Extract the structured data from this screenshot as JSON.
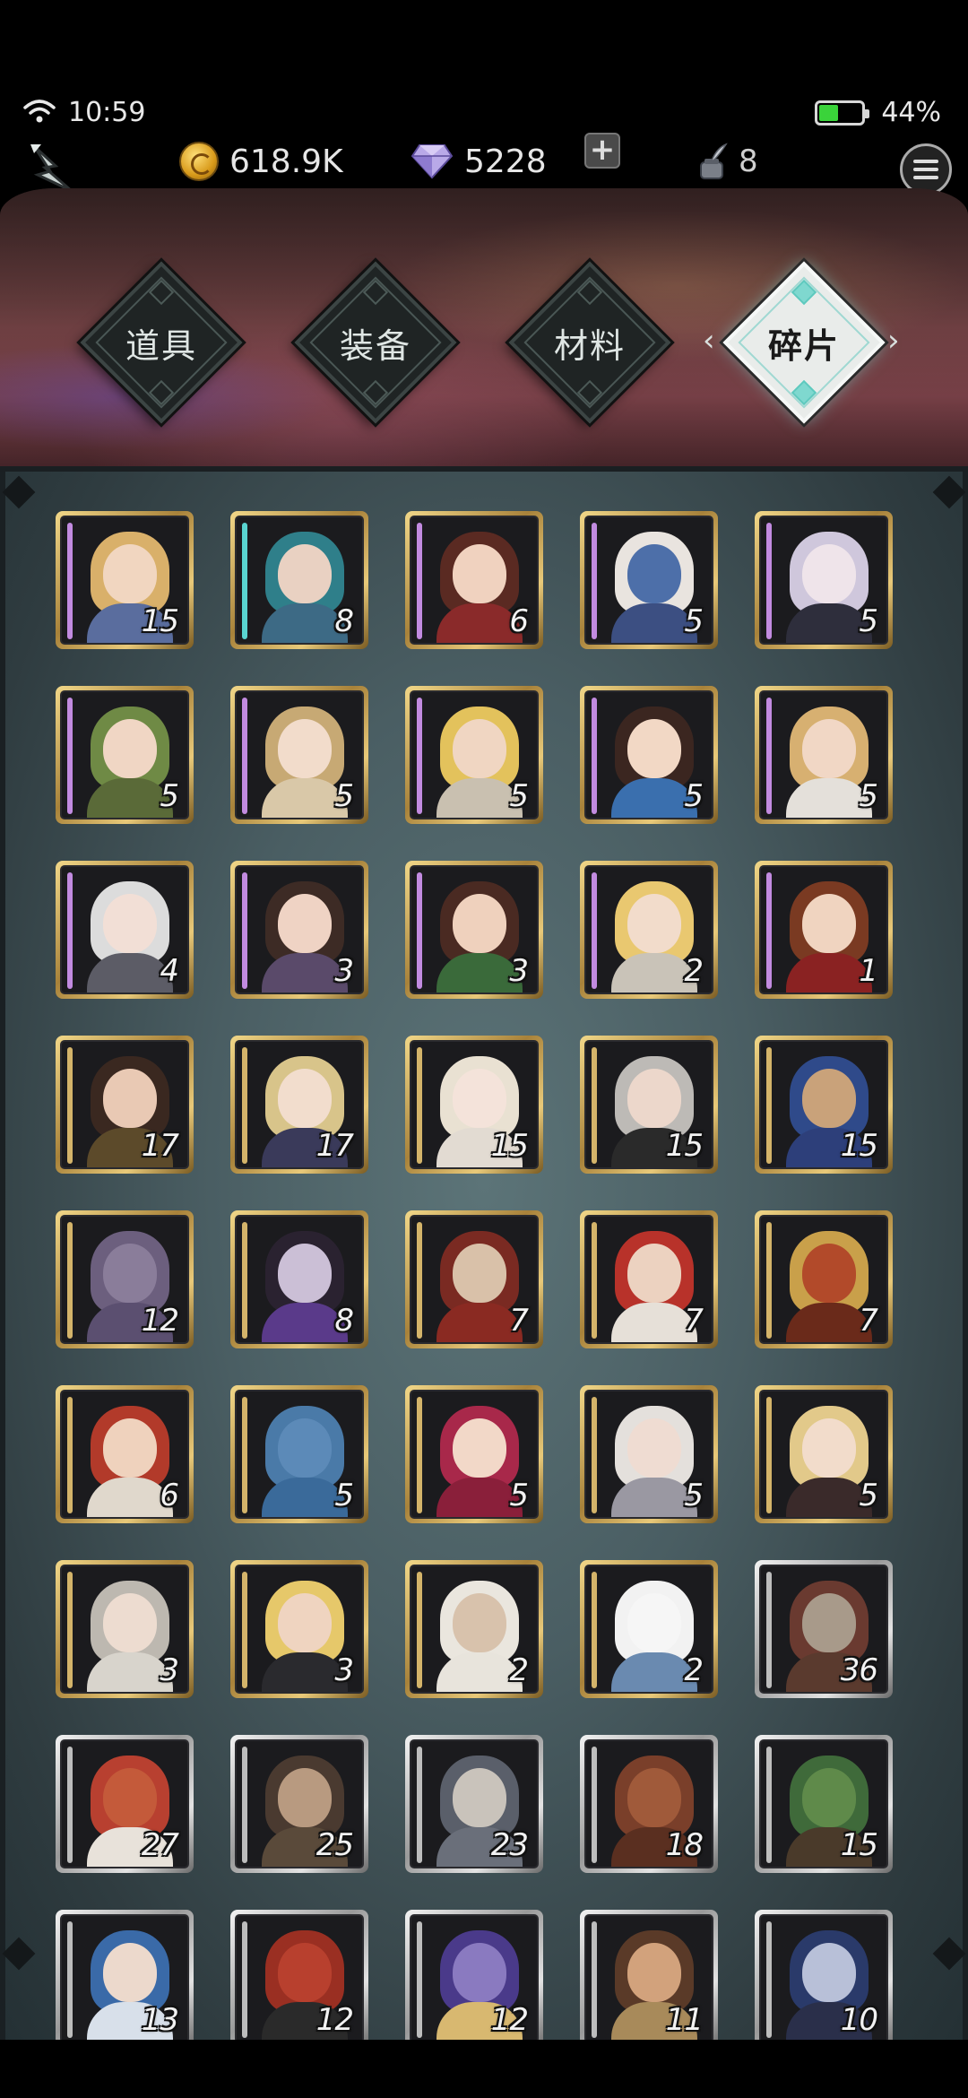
{
  "status_bar": {
    "time": "10:59",
    "battery_percent": "44%",
    "battery_level": 0.44
  },
  "resources": {
    "gold": "618.9K",
    "gems": "5228",
    "ink": "8"
  },
  "tabs": [
    {
      "label": "道具",
      "active": false
    },
    {
      "label": "装备",
      "active": false
    },
    {
      "label": "材料",
      "active": false
    },
    {
      "label": "碎片",
      "active": true
    }
  ],
  "icons": {
    "back": "back-arrow-icon",
    "gold": "gold-coin-icon",
    "gem": "diamond-gem-icon",
    "add": "plus-icon",
    "ink": "ink-quill-icon",
    "menu": "hamburger-menu-icon",
    "wifi": "wifi-icon",
    "battery": "battery-icon"
  },
  "colors": {
    "frame_gold": "#d4b46a",
    "frame_silver": "#d0d0d0",
    "active_tab": "#e9ecea",
    "accent_teal": "#5ec9be"
  },
  "fragments": [
    {
      "count": "15",
      "frame": "gold",
      "hair": "#d9b06a",
      "skin": "#f1d6c0",
      "outfit": "#5a6d9e",
      "edge": "#c28be0"
    },
    {
      "count": "8",
      "frame": "gold",
      "hair": "#2f7f8a",
      "skin": "#e9d1c2",
      "outfit": "#3d6a85",
      "edge": "#59d4d0"
    },
    {
      "count": "6",
      "frame": "gold",
      "hair": "#5a2a22",
      "skin": "#f0d2bf",
      "outfit": "#8a2a2a",
      "edge": "#c28be0"
    },
    {
      "count": "5",
      "frame": "gold",
      "hair": "#e9e4df",
      "skin": "#4d6fa9",
      "outfit": "#3c4f82",
      "edge": "#c28be0"
    },
    {
      "count": "5",
      "frame": "gold",
      "hair": "#cfc7dc",
      "skin": "#efe4ea",
      "outfit": "#2e2e3c",
      "edge": "#c28be0"
    },
    {
      "count": "5",
      "frame": "gold",
      "hair": "#6f8a45",
      "skin": "#f0d6c4",
      "outfit": "#5a6a38",
      "edge": "#c28be0"
    },
    {
      "count": "5",
      "frame": "gold",
      "hair": "#c7a974",
      "skin": "#f2dccb",
      "outfit": "#d9c8a8",
      "edge": "#c28be0"
    },
    {
      "count": "5",
      "frame": "gold",
      "hair": "#e3c25c",
      "skin": "#f0d6c2",
      "outfit": "#c9c0b0",
      "edge": "#c28be0"
    },
    {
      "count": "5",
      "frame": "gold",
      "hair": "#3b2620",
      "skin": "#f2d8c5",
      "outfit": "#3a6fae",
      "edge": "#c28be0"
    },
    {
      "count": "5",
      "frame": "gold",
      "hair": "#d7b071",
      "skin": "#f1d7c5",
      "outfit": "#e4e0da",
      "edge": "#c28be0"
    },
    {
      "count": "4",
      "frame": "gold",
      "hair": "#dcdcdc",
      "skin": "#f2dfd6",
      "outfit": "#5c5c66",
      "edge": "#c28be0"
    },
    {
      "count": "3",
      "frame": "gold",
      "hair": "#3d2b25",
      "skin": "#efd3c4",
      "outfit": "#5a4a6a",
      "edge": "#c28be0"
    },
    {
      "count": "3",
      "frame": "gold",
      "hair": "#4a2a22",
      "skin": "#efd1bd",
      "outfit": "#3a6a3a",
      "edge": "#c28be0"
    },
    {
      "count": "2",
      "frame": "gold",
      "hair": "#e9c870",
      "skin": "#f2dccb",
      "outfit": "#c9c3b8",
      "edge": "#c28be0"
    },
    {
      "count": "1",
      "frame": "gold",
      "hair": "#7a3a22",
      "skin": "#f0d4c0",
      "outfit": "#8a2222",
      "edge": "#c28be0"
    },
    {
      "count": "17",
      "frame": "gold",
      "hair": "#3a2820",
      "skin": "#e9c9b4",
      "outfit": "#5c4a2a",
      "edge": "#d4b46a"
    },
    {
      "count": "17",
      "frame": "gold",
      "hair": "#d8c48a",
      "skin": "#f2ddcd",
      "outfit": "#3a3a5a",
      "edge": "#d4b46a"
    },
    {
      "count": "15",
      "frame": "gold",
      "hair": "#e9e1d2",
      "skin": "#f4e3da",
      "outfit": "#e2dbd2",
      "edge": "#d4b46a"
    },
    {
      "count": "15",
      "frame": "gold",
      "hair": "#bdbab6",
      "skin": "#ecd7cb",
      "outfit": "#2a2a2a",
      "edge": "#d4b46a"
    },
    {
      "count": "15",
      "frame": "gold",
      "hair": "#2f4a8a",
      "skin": "#c9a27a",
      "outfit": "#2d3f7a",
      "edge": "#d4b46a"
    },
    {
      "count": "12",
      "frame": "gold",
      "hair": "#6c5f7e",
      "skin": "#8a7d9a",
      "outfit": "#5b4f70",
      "edge": "#d4b46a"
    },
    {
      "count": "8",
      "frame": "gold",
      "hair": "#2a2230",
      "skin": "#cbbfd6",
      "outfit": "#5a3a8a",
      "edge": "#d4b46a"
    },
    {
      "count": "7",
      "frame": "gold",
      "hair": "#7a2a22",
      "skin": "#d9c1a9",
      "outfit": "#8a2a22",
      "edge": "#d4b46a"
    },
    {
      "count": "7",
      "frame": "gold",
      "hair": "#b8322a",
      "skin": "#ecd2c0",
      "outfit": "#e6e0d8",
      "edge": "#d4b46a"
    },
    {
      "count": "7",
      "frame": "gold",
      "hair": "#c9a04a",
      "skin": "#b24a2a",
      "outfit": "#6a2a1a",
      "edge": "#d4b46a"
    },
    {
      "count": "6",
      "frame": "gold",
      "hair": "#b23a2a",
      "skin": "#efd2bd",
      "outfit": "#e0d8cc",
      "edge": "#d4b46a"
    },
    {
      "count": "5",
      "frame": "gold",
      "hair": "#4a7aa8",
      "skin": "#5c8ab8",
      "outfit": "#3a6a9a",
      "edge": "#d4b46a"
    },
    {
      "count": "5",
      "frame": "gold",
      "hair": "#a8284a",
      "skin": "#f2d8c8",
      "outfit": "#8a1f3a",
      "edge": "#d4b46a"
    },
    {
      "count": "5",
      "frame": "gold",
      "hair": "#e4e0dc",
      "skin": "#efdcd2",
      "outfit": "#9a98a2",
      "edge": "#d4b46a"
    },
    {
      "count": "5",
      "frame": "gold",
      "hair": "#e2c98a",
      "skin": "#f2dccb",
      "outfit": "#3a2a2a",
      "edge": "#d4b46a"
    },
    {
      "count": "3",
      "frame": "gold",
      "hair": "#bdb8b0",
      "skin": "#eddcd0",
      "outfit": "#d8d4cc",
      "edge": "#d4b46a"
    },
    {
      "count": "3",
      "frame": "gold",
      "hair": "#e6c86a",
      "skin": "#efd4c0",
      "outfit": "#2a2a2e",
      "edge": "#d4b46a"
    },
    {
      "count": "2",
      "frame": "gold",
      "hair": "#eae6de",
      "skin": "#d8c2ac",
      "outfit": "#e8e4dc",
      "edge": "#d4b46a"
    },
    {
      "count": "2",
      "frame": "gold",
      "hair": "#f2f2f2",
      "skin": "#f6f6f6",
      "outfit": "#6a8ab0",
      "edge": "#d4b46a"
    },
    {
      "count": "36",
      "frame": "silver",
      "hair": "#6a3a30",
      "skin": "#a89a8a",
      "outfit": "#5a3a2e",
      "edge": "#bdbdbd"
    },
    {
      "count": "27",
      "frame": "silver",
      "hair": "#b84030",
      "skin": "#c45a3a",
      "outfit": "#e8e2da",
      "edge": "#bdbdbd"
    },
    {
      "count": "25",
      "frame": "silver",
      "hair": "#4a3a30",
      "skin": "#b89a80",
      "outfit": "#5a4a3a",
      "edge": "#bdbdbd"
    },
    {
      "count": "23",
      "frame": "silver",
      "hair": "#5a5f6a",
      "skin": "#c9c3bb",
      "outfit": "#6a6f7a",
      "edge": "#bdbdbd"
    },
    {
      "count": "18",
      "frame": "silver",
      "hair": "#7a3f2a",
      "skin": "#a05a3a",
      "outfit": "#5a2f20",
      "edge": "#bdbdbd"
    },
    {
      "count": "15",
      "frame": "silver",
      "hair": "#3f6a3a",
      "skin": "#5f8a4a",
      "outfit": "#4a3a2a",
      "edge": "#bdbdbd"
    },
    {
      "count": "13",
      "frame": "silver",
      "hair": "#3a6aa8",
      "skin": "#ecd9cc",
      "outfit": "#d8e0ea",
      "edge": "#bdbdbd"
    },
    {
      "count": "12",
      "frame": "silver",
      "hair": "#9a2f22",
      "skin": "#b8402e",
      "outfit": "#2a2a2a",
      "edge": "#bdbdbd"
    },
    {
      "count": "12",
      "frame": "silver",
      "hair": "#4a3a8a",
      "skin": "#8a7ac0",
      "outfit": "#d8b870",
      "edge": "#bdbdbd"
    },
    {
      "count": "11",
      "frame": "silver",
      "hair": "#5a3a28",
      "skin": "#d2a27c",
      "outfit": "#a88a5a",
      "edge": "#bdbdbd"
    },
    {
      "count": "10",
      "frame": "silver",
      "hair": "#2a3a6a",
      "skin": "#b8c0d8",
      "outfit": "#2a2f4a",
      "edge": "#bdbdbd"
    }
  ]
}
